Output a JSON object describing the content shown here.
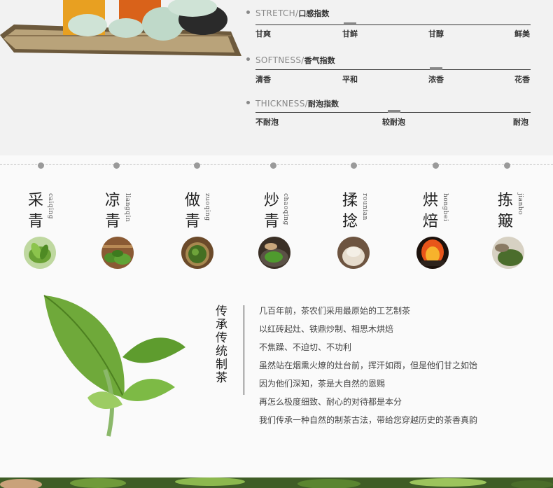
{
  "indexes": [
    {
      "en": "STRETCH",
      "cn": "口感指数",
      "level": "甘鲜",
      "labels": [
        "甘爽",
        "甘鲜",
        "甘醇",
        "鲜美"
      ]
    },
    {
      "en": "SOFTNESS",
      "cn": "香气指数",
      "level": "浓香",
      "labels": [
        "清香",
        "平和",
        "浓香",
        "花香"
      ]
    },
    {
      "en": "THICKNESS",
      "cn": "耐泡指数",
      "level": "较耐泡",
      "labels": [
        "不耐泡",
        "较耐泡",
        "耐泡"
      ]
    }
  ],
  "steps": [
    {
      "cn": "采青",
      "pinyin": "caiqing",
      "image": "tea-bud-photo"
    },
    {
      "cn": "凉青",
      "pinyin": "liangqin",
      "image": "spread-leaves-photo"
    },
    {
      "cn": "做青",
      "pinyin": "zuoqing",
      "image": "tea-tray-photo"
    },
    {
      "cn": "炒青",
      "pinyin": "chaoqing",
      "image": "wok-frying-photo"
    },
    {
      "cn": "揉捻",
      "pinyin": "rounian",
      "image": "rolled-bundle-photo"
    },
    {
      "cn": "烘焙",
      "pinyin": "hongbei",
      "image": "charcoal-fire-photo"
    },
    {
      "cn": "拣簸",
      "pinyin": "jianbo",
      "image": "sorting-tray-photo"
    }
  ],
  "craft": {
    "title": "传承传统制茶",
    "lines": [
      "几百年前，茶农们采用最原始的工艺制茶",
      "以红砖起灶、铁鼎炒制、相思木烘焙",
      "不焦躁、不迫切、不功利",
      "虽然站在烟熏火燎的灶台前，挥汗如雨，但是他们甘之如饴",
      "因为他们深知，茶是大自然的恩赐",
      "再怎么极度细致、耐心的对待都是本分",
      "我们传承一种自然的制茶古法，带给您穿越历史的茶香真韵"
    ]
  },
  "colors": {
    "background": "#f2f2f2",
    "marker": "#888888",
    "leaf": "#6faa3a"
  }
}
